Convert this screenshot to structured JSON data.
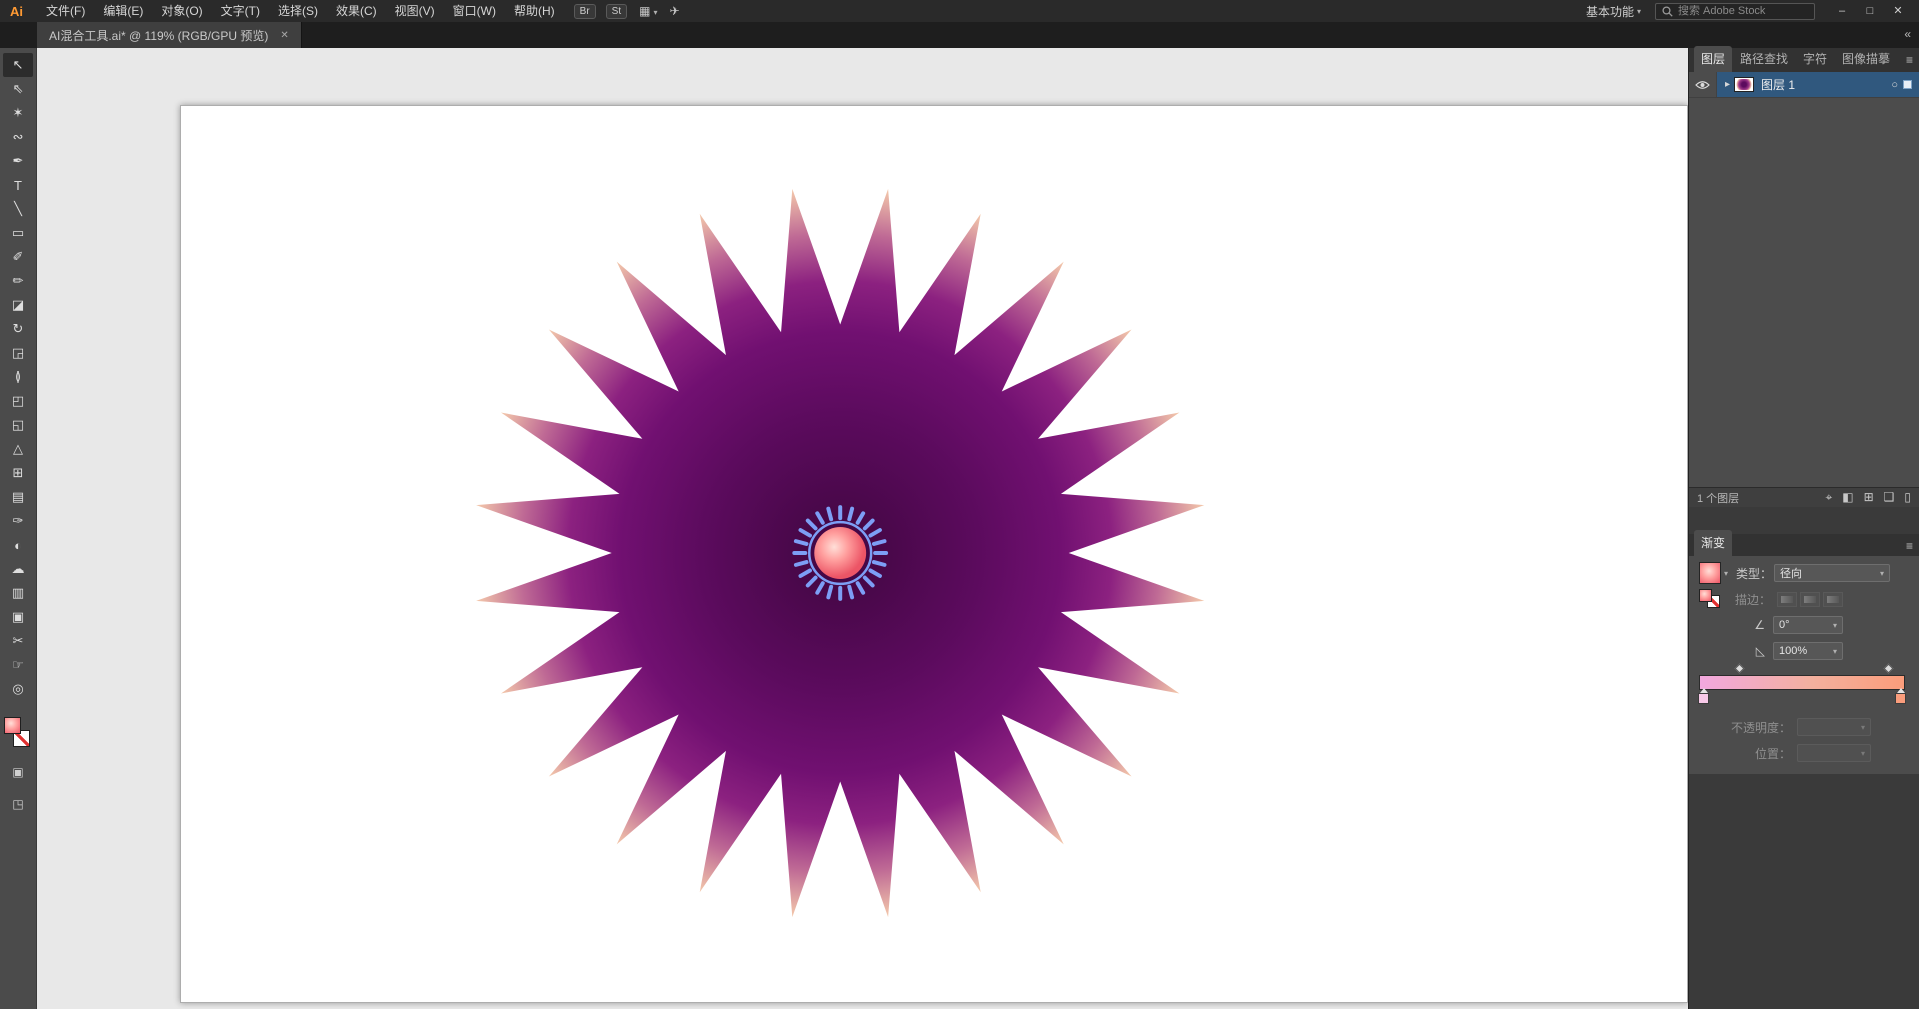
{
  "top_bar": {
    "logo": "Ai",
    "menus": [
      "文件(F)",
      "编辑(E)",
      "对象(O)",
      "文字(T)",
      "选择(S)",
      "效果(C)",
      "视图(V)",
      "窗口(W)",
      "帮助(H)"
    ],
    "bridge_button": "Br",
    "stock_button": "St",
    "workspace": "基本功能",
    "search_placeholder": "搜索 Adobe Stock",
    "window_controls": {
      "minimize": "–",
      "restore": "□",
      "close": "✕"
    }
  },
  "document_tab": {
    "title": "AI混合工具.ai* @ 119% (RGB/GPU 预览)",
    "close_glyph": "✕"
  },
  "toolbar": {
    "tools": [
      {
        "label": "选择工具",
        "glyph": "↖"
      },
      {
        "label": "直接选择工具",
        "glyph": "⇖"
      },
      {
        "label": "魔棒工具",
        "glyph": "✶"
      },
      {
        "label": "套索工具",
        "glyph": "∾"
      },
      {
        "label": "钢笔工具",
        "glyph": "✒"
      },
      {
        "label": "文字工具",
        "glyph": "T"
      },
      {
        "label": "直线段工具",
        "glyph": "╲"
      },
      {
        "label": "矩形工具",
        "glyph": "▭"
      },
      {
        "label": "画笔工具",
        "glyph": "✐"
      },
      {
        "label": "铅笔工具",
        "glyph": "✏"
      },
      {
        "label": "橡皮擦工具",
        "glyph": "◪"
      },
      {
        "label": "旋转工具",
        "glyph": "↻"
      },
      {
        "label": "比例缩放工具",
        "glyph": "◲"
      },
      {
        "label": "宽度工具",
        "glyph": "≬"
      },
      {
        "label": "自由变换工具",
        "glyph": "◰"
      },
      {
        "label": "形状生成器工具",
        "glyph": "◱"
      },
      {
        "label": "透视网格工具",
        "glyph": "△"
      },
      {
        "label": "网格工具",
        "glyph": "⊞"
      },
      {
        "label": "渐变工具",
        "glyph": "▤"
      },
      {
        "label": "吸管工具",
        "glyph": "✑"
      },
      {
        "label": "混合工具",
        "glyph": "◐"
      },
      {
        "label": "符号喷枪工具",
        "glyph": "☁"
      },
      {
        "label": "柱形图工具",
        "glyph": "▥"
      },
      {
        "label": "画板工具",
        "glyph": "▣"
      },
      {
        "label": "切片工具",
        "glyph": "✂"
      },
      {
        "label": "抓手工具",
        "glyph": "☞"
      },
      {
        "label": "缩放工具",
        "glyph": "◎"
      }
    ]
  },
  "canvas": {
    "artwork": {
      "spike_count": 24,
      "ring_tick_count": 24
    }
  },
  "dock": {
    "panel_tabs": [
      "图层",
      "路径查找",
      "字符",
      "图像描摹"
    ],
    "layers": {
      "row": {
        "label": "图层 1"
      },
      "footer": {
        "count_text": "1 个图层",
        "icons": [
          {
            "name": "locate-object",
            "glyph": "⌖"
          },
          {
            "name": "make-clipping-mask",
            "glyph": "◧"
          },
          {
            "name": "new-sublayer",
            "glyph": "⊞"
          },
          {
            "name": "new-layer",
            "glyph": "❑"
          },
          {
            "name": "delete-layer",
            "glyph": "▯"
          }
        ]
      }
    },
    "gradient": {
      "title": "渐变",
      "type_label": "类型：",
      "type_value": "径向",
      "stroke_label": "描边：",
      "angle_value": "0°",
      "aspect_value": "100%",
      "opacity_label": "不透明度：",
      "position_label": "位置："
    }
  },
  "ui": {
    "chevron_down": "▾",
    "expand_arrow": "▸",
    "menu_glyph": "≡",
    "collapse_glyph": "«",
    "target_glyph": "○",
    "angle_glyph": "∠",
    "aspect_glyph": "◺"
  },
  "colors": {
    "selection_blue": "#30587e",
    "star_center": "#400640",
    "star_mid": "#711071",
    "star_tip": "#f4c9ab",
    "ring_blue": "#7d9ef5",
    "ball_highlight": "#ffdfd8",
    "ball_edge": "#ec5566",
    "gradient_bar_left": "#f2a8df",
    "gradient_bar_right": "#fb9d7b"
  }
}
